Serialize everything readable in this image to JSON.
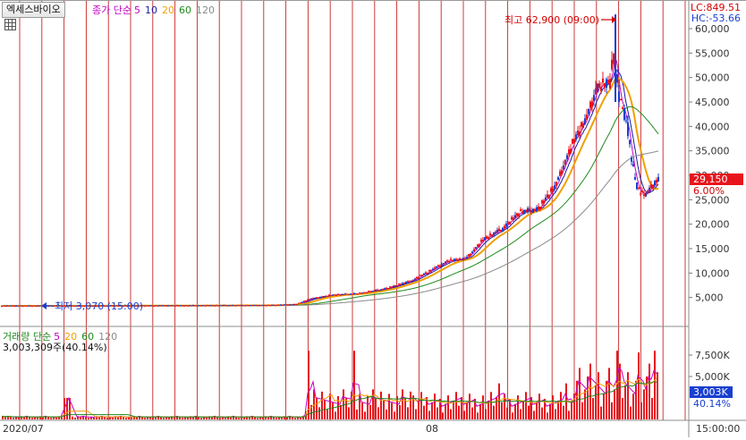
{
  "header": {
    "stock_name": "엑세스바이오",
    "price_legend": {
      "label": "종가 단순",
      "periods": [
        "5",
        "10",
        "20",
        "60",
        "120"
      ]
    },
    "lc_label": "LC:849.51",
    "hc_label": "HC:-53.66"
  },
  "colors": {
    "candle_up": "#e8141c",
    "candle_down": "#1a3fd0",
    "ma5": "#c400c4",
    "ma10": "#1a1aa0",
    "ma20": "#f0a000",
    "ma60": "#1e8a1e",
    "ma120": "#8a8a8a",
    "vertical_grid": "#c00000",
    "price_tag_bg": "#e8141c",
    "volume_tag_bg": "#1a3fd0"
  },
  "volume_panel": {
    "legend_label": "거래량 단순",
    "periods": [
      "5",
      "20",
      "60",
      "120"
    ],
    "value_text": "3,003,309주(40.14%)",
    "current_tag": "3,003K",
    "current_pct": "40.14%"
  },
  "chart_data": [
    {
      "type": "candlestick",
      "ylim": [
        0,
        65000
      ],
      "y_ticks": [
        "5,000",
        "10,000",
        "15,000",
        "20,000",
        "25,000",
        "30,000",
        "35,000",
        "40,000",
        "45,000",
        "50,000",
        "55,000",
        "60,000"
      ],
      "x_labels": [
        "2020/07",
        "08",
        "15:00:00"
      ],
      "annotations": {
        "high": "최고 62,900 (09:00)",
        "low": "최저 3,070 (15:00)"
      },
      "current_price": "29,150",
      "current_change": "6.00%",
      "series_breakpoints": {
        "x": [
          0,
          100,
          200,
          300,
          330,
          345,
          370,
          400,
          430,
          460,
          480,
          500,
          520,
          540,
          560,
          580,
          600,
          620,
          640,
          655,
          665,
          672,
          680,
          686,
          690,
          695,
          700,
          705,
          710,
          715,
          720,
          725,
          730,
          735
        ],
        "close": [
          3300,
          3300,
          3350,
          3400,
          3600,
          4700,
          5500,
          5800,
          6800,
          8500,
          10500,
          12500,
          13000,
          17000,
          19000,
          22500,
          23000,
          28000,
          37000,
          42000,
          47500,
          48500,
          49000,
          56000,
          46000,
          44000,
          40000,
          33000,
          28000,
          26500,
          26000,
          27000,
          28500,
          29150
        ]
      },
      "moving_averages": [
        "5",
        "10",
        "20",
        "60",
        "120"
      ]
    },
    {
      "type": "bar",
      "ylim": [
        0,
        10500
      ],
      "y_ticks": [
        "5,000K",
        "7,500K"
      ],
      "unit": "K shares"
    }
  ]
}
